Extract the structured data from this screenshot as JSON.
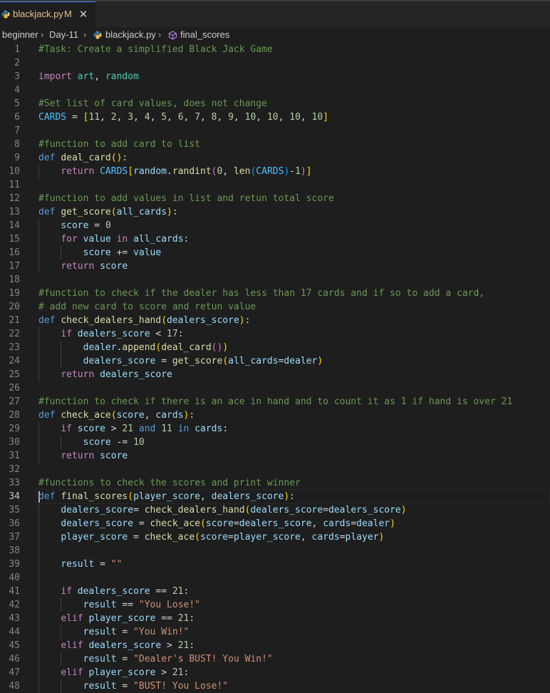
{
  "tab": {
    "filename": "blackjack.py",
    "modified": "M",
    "close_glyph": "✕"
  },
  "breadcrumb": [
    "beginner",
    "Day-11",
    "blackjack.py",
    "final_scores"
  ],
  "breadcrumb_sep": "›",
  "active_line": 34,
  "lines": [
    [
      [
        "cm",
        "#Task: Create a simplified Black Jack Game"
      ]
    ],
    [],
    [
      [
        "ctl",
        "import"
      ],
      [
        "op",
        " "
      ],
      [
        "mod",
        "art"
      ],
      [
        "op",
        ", "
      ],
      [
        "mod",
        "random"
      ]
    ],
    [],
    [
      [
        "cm",
        "#Set list of card values, does not change"
      ]
    ],
    [
      [
        "const",
        "CARDS"
      ],
      [
        "op",
        " = "
      ],
      [
        "b1",
        "["
      ],
      [
        "num",
        "11"
      ],
      [
        "op",
        ", "
      ],
      [
        "num",
        "2"
      ],
      [
        "op",
        ", "
      ],
      [
        "num",
        "3"
      ],
      [
        "op",
        ", "
      ],
      [
        "num",
        "4"
      ],
      [
        "op",
        ", "
      ],
      [
        "num",
        "5"
      ],
      [
        "op",
        ", "
      ],
      [
        "num",
        "6"
      ],
      [
        "op",
        ", "
      ],
      [
        "num",
        "7"
      ],
      [
        "op",
        ", "
      ],
      [
        "num",
        "8"
      ],
      [
        "op",
        ", "
      ],
      [
        "num",
        "9"
      ],
      [
        "op",
        ", "
      ],
      [
        "num",
        "10"
      ],
      [
        "op",
        ", "
      ],
      [
        "num",
        "10"
      ],
      [
        "op",
        ", "
      ],
      [
        "num",
        "10"
      ],
      [
        "op",
        ", "
      ],
      [
        "num",
        "10"
      ],
      [
        "b1",
        "]"
      ]
    ],
    [],
    [
      [
        "cm",
        "#function to add card to list"
      ]
    ],
    [
      [
        "kw",
        "def"
      ],
      [
        "op",
        " "
      ],
      [
        "fn",
        "deal_card"
      ],
      [
        "b1",
        "()"
      ],
      [
        "op",
        ":"
      ]
    ],
    [
      [
        "op",
        "    "
      ],
      [
        "ctl",
        "return"
      ],
      [
        "op",
        " "
      ],
      [
        "const",
        "CARDS"
      ],
      [
        "b1",
        "["
      ],
      [
        "var",
        "random"
      ],
      [
        "op",
        "."
      ],
      [
        "fn",
        "randint"
      ],
      [
        "b2",
        "("
      ],
      [
        "num",
        "0"
      ],
      [
        "op",
        ", "
      ],
      [
        "fn",
        "len"
      ],
      [
        "b3",
        "("
      ],
      [
        "const",
        "CARDS"
      ],
      [
        "b3",
        ")"
      ],
      [
        "op",
        "-"
      ],
      [
        "num",
        "1"
      ],
      [
        "b2",
        ")"
      ],
      [
        "b1",
        "]"
      ]
    ],
    [],
    [
      [
        "cm",
        "#function to add values in list and retun total score"
      ]
    ],
    [
      [
        "kw",
        "def"
      ],
      [
        "op",
        " "
      ],
      [
        "fn",
        "get_score"
      ],
      [
        "b1",
        "("
      ],
      [
        "var",
        "all_cards"
      ],
      [
        "b1",
        ")"
      ],
      [
        "op",
        ":"
      ]
    ],
    [
      [
        "op",
        "    "
      ],
      [
        "var",
        "score"
      ],
      [
        "op",
        " = "
      ],
      [
        "num",
        "0"
      ]
    ],
    [
      [
        "op",
        "    "
      ],
      [
        "ctl",
        "for"
      ],
      [
        "op",
        " "
      ],
      [
        "var",
        "value"
      ],
      [
        "op",
        " "
      ],
      [
        "ctl",
        "in"
      ],
      [
        "op",
        " "
      ],
      [
        "var",
        "all_cards"
      ],
      [
        "op",
        ":"
      ]
    ],
    [
      [
        "op",
        "        "
      ],
      [
        "var",
        "score"
      ],
      [
        "op",
        " += "
      ],
      [
        "var",
        "value"
      ]
    ],
    [
      [
        "op",
        "    "
      ],
      [
        "ctl",
        "return"
      ],
      [
        "op",
        " "
      ],
      [
        "var",
        "score"
      ]
    ],
    [],
    [
      [
        "cm",
        "#function to check if the dealer has less than 17 cards and if so to add a card,"
      ]
    ],
    [
      [
        "cm",
        "# add new card to score and retun value"
      ]
    ],
    [
      [
        "kw",
        "def"
      ],
      [
        "op",
        " "
      ],
      [
        "fn",
        "check_dealers_hand"
      ],
      [
        "b1",
        "("
      ],
      [
        "var",
        "dealers_score"
      ],
      [
        "b1",
        ")"
      ],
      [
        "op",
        ":"
      ]
    ],
    [
      [
        "op",
        "    "
      ],
      [
        "ctl",
        "if"
      ],
      [
        "op",
        " "
      ],
      [
        "var",
        "dealers_score"
      ],
      [
        "op",
        " < "
      ],
      [
        "num",
        "17"
      ],
      [
        "op",
        ":"
      ]
    ],
    [
      [
        "op",
        "        "
      ],
      [
        "var",
        "dealer"
      ],
      [
        "op",
        "."
      ],
      [
        "fn",
        "append"
      ],
      [
        "b1",
        "("
      ],
      [
        "fn",
        "deal_card"
      ],
      [
        "b2",
        "()"
      ],
      [
        "b1",
        ")"
      ]
    ],
    [
      [
        "op",
        "        "
      ],
      [
        "var",
        "dealers_score"
      ],
      [
        "op",
        " = "
      ],
      [
        "fn",
        "get_score"
      ],
      [
        "b1",
        "("
      ],
      [
        "var",
        "all_cards"
      ],
      [
        "op",
        "="
      ],
      [
        "var",
        "dealer"
      ],
      [
        "b1",
        ")"
      ]
    ],
    [
      [
        "op",
        "    "
      ],
      [
        "ctl",
        "return"
      ],
      [
        "op",
        " "
      ],
      [
        "var",
        "dealers_score"
      ]
    ],
    [],
    [
      [
        "cm",
        "#function to check if there is an ace in hand and to count it as 1 if hand is over 21"
      ]
    ],
    [
      [
        "kw",
        "def"
      ],
      [
        "op",
        " "
      ],
      [
        "fn",
        "check_ace"
      ],
      [
        "b1",
        "("
      ],
      [
        "var",
        "score"
      ],
      [
        "op",
        ", "
      ],
      [
        "var",
        "cards"
      ],
      [
        "b1",
        ")"
      ],
      [
        "op",
        ":"
      ]
    ],
    [
      [
        "op",
        "    "
      ],
      [
        "ctl",
        "if"
      ],
      [
        "op",
        " "
      ],
      [
        "var",
        "score"
      ],
      [
        "op",
        " > "
      ],
      [
        "num",
        "21"
      ],
      [
        "op",
        " "
      ],
      [
        "kw",
        "and"
      ],
      [
        "op",
        " "
      ],
      [
        "num",
        "11"
      ],
      [
        "op",
        " "
      ],
      [
        "kw",
        "in"
      ],
      [
        "op",
        " "
      ],
      [
        "var",
        "cards"
      ],
      [
        "op",
        ":"
      ]
    ],
    [
      [
        "op",
        "        "
      ],
      [
        "var",
        "score"
      ],
      [
        "op",
        " -= "
      ],
      [
        "num",
        "10"
      ]
    ],
    [
      [
        "op",
        "    "
      ],
      [
        "ctl",
        "return"
      ],
      [
        "op",
        " "
      ],
      [
        "var",
        "score"
      ]
    ],
    [],
    [
      [
        "cm",
        "#functions to check the scores and print winner"
      ]
    ],
    [
      [
        "kw",
        "def"
      ],
      [
        "op",
        " "
      ],
      [
        "fn",
        "final_scores"
      ],
      [
        "b1",
        "("
      ],
      [
        "var",
        "player_score"
      ],
      [
        "op",
        ", "
      ],
      [
        "var",
        "dealers_score"
      ],
      [
        "b1",
        ")"
      ],
      [
        "op",
        ":"
      ]
    ],
    [
      [
        "op",
        "    "
      ],
      [
        "var",
        "dealers_score"
      ],
      [
        "op",
        "= "
      ],
      [
        "fn",
        "check_dealers_hand"
      ],
      [
        "b1",
        "("
      ],
      [
        "var",
        "dealers_score"
      ],
      [
        "op",
        "="
      ],
      [
        "var",
        "dealers_score"
      ],
      [
        "b1",
        ")"
      ]
    ],
    [
      [
        "op",
        "    "
      ],
      [
        "var",
        "dealers_score"
      ],
      [
        "op",
        " = "
      ],
      [
        "fn",
        "check_ace"
      ],
      [
        "b1",
        "("
      ],
      [
        "var",
        "score"
      ],
      [
        "op",
        "="
      ],
      [
        "var",
        "dealers_score"
      ],
      [
        "op",
        ", "
      ],
      [
        "var",
        "cards"
      ],
      [
        "op",
        "="
      ],
      [
        "var",
        "dealer"
      ],
      [
        "b1",
        ")"
      ]
    ],
    [
      [
        "op",
        "    "
      ],
      [
        "var",
        "player_score"
      ],
      [
        "op",
        " = "
      ],
      [
        "fn",
        "check_ace"
      ],
      [
        "b1",
        "("
      ],
      [
        "var",
        "score"
      ],
      [
        "op",
        "="
      ],
      [
        "var",
        "player_score"
      ],
      [
        "op",
        ", "
      ],
      [
        "var",
        "cards"
      ],
      [
        "op",
        "="
      ],
      [
        "var",
        "player"
      ],
      [
        "b1",
        ")"
      ]
    ],
    [],
    [
      [
        "op",
        "    "
      ],
      [
        "var",
        "result"
      ],
      [
        "op",
        " = "
      ],
      [
        "str",
        "\"\""
      ]
    ],
    [],
    [
      [
        "op",
        "    "
      ],
      [
        "ctl",
        "if"
      ],
      [
        "op",
        " "
      ],
      [
        "var",
        "dealers_score"
      ],
      [
        "op",
        " == "
      ],
      [
        "num",
        "21"
      ],
      [
        "op",
        ":"
      ]
    ],
    [
      [
        "op",
        "        "
      ],
      [
        "var",
        "result"
      ],
      [
        "op",
        " == "
      ],
      [
        "str",
        "\"You Lose!\""
      ]
    ],
    [
      [
        "op",
        "    "
      ],
      [
        "ctl",
        "elif"
      ],
      [
        "op",
        " "
      ],
      [
        "var",
        "player_score"
      ],
      [
        "op",
        " == "
      ],
      [
        "num",
        "21"
      ],
      [
        "op",
        ":"
      ]
    ],
    [
      [
        "op",
        "        "
      ],
      [
        "var",
        "result"
      ],
      [
        "op",
        " = "
      ],
      [
        "str",
        "\"You Win!\""
      ]
    ],
    [
      [
        "op",
        "    "
      ],
      [
        "ctl",
        "elif"
      ],
      [
        "op",
        " "
      ],
      [
        "var",
        "dealers_score"
      ],
      [
        "op",
        " > "
      ],
      [
        "num",
        "21"
      ],
      [
        "op",
        ":"
      ]
    ],
    [
      [
        "op",
        "        "
      ],
      [
        "var",
        "result"
      ],
      [
        "op",
        " = "
      ],
      [
        "str",
        "\"Dealer's BUST! You Win!\""
      ]
    ],
    [
      [
        "op",
        "    "
      ],
      [
        "ctl",
        "elif"
      ],
      [
        "op",
        " "
      ],
      [
        "var",
        "player_score"
      ],
      [
        "op",
        " > "
      ],
      [
        "num",
        "21"
      ],
      [
        "op",
        ":"
      ]
    ],
    [
      [
        "op",
        "        "
      ],
      [
        "var",
        "result"
      ],
      [
        "op",
        " = "
      ],
      [
        "str",
        "\"BUST! You Lose!\""
      ]
    ]
  ]
}
